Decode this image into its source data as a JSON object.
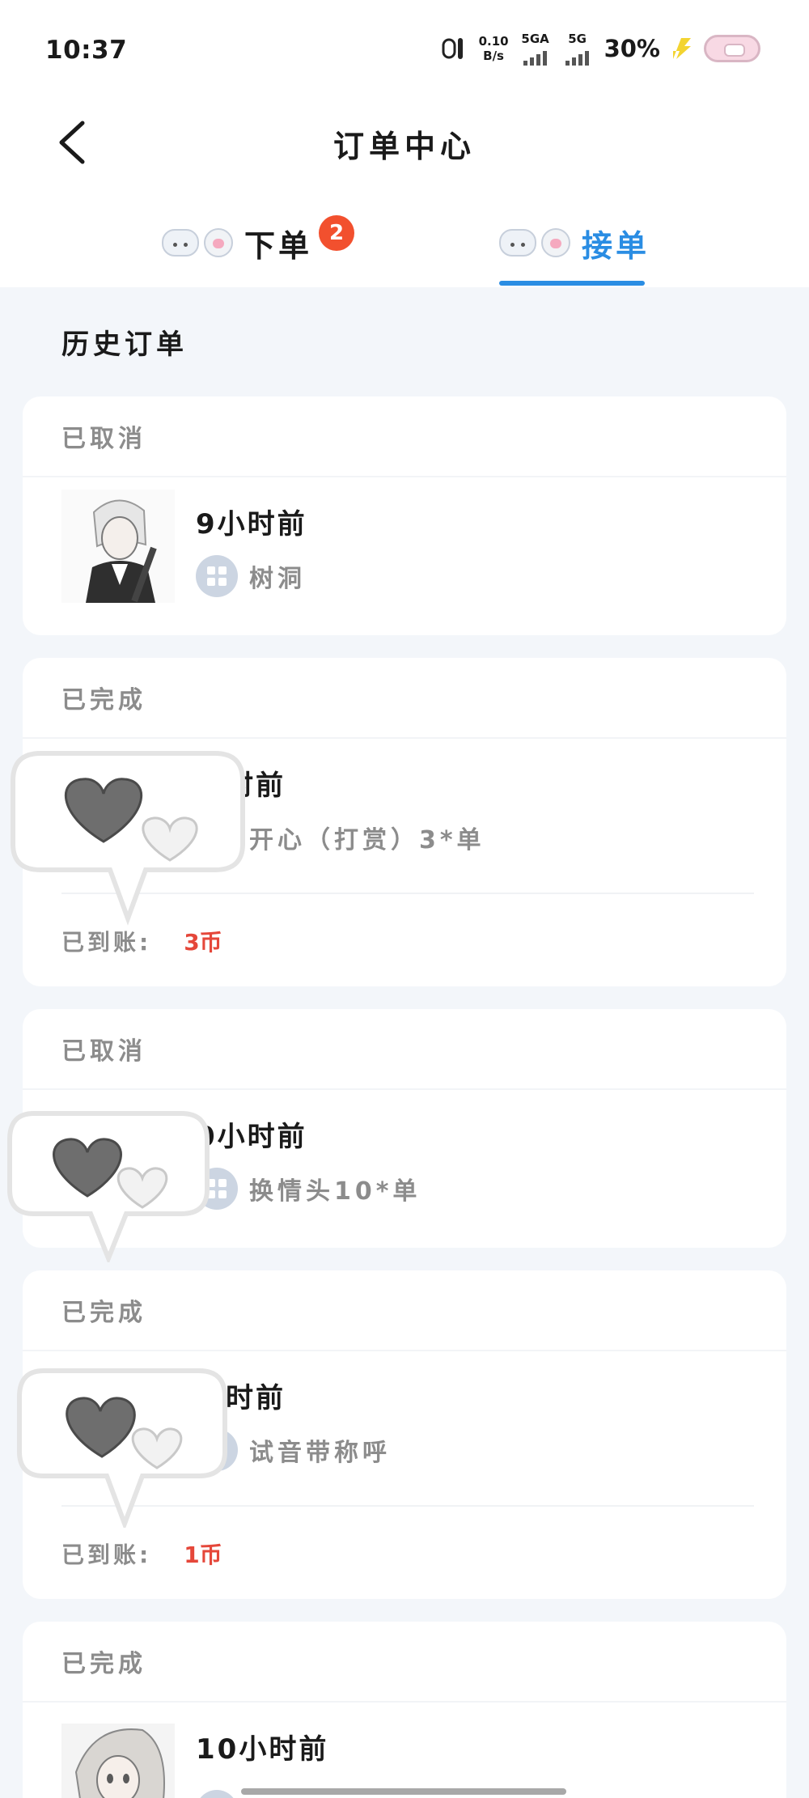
{
  "status_bar": {
    "time": "10:37",
    "net_speed": "0.10",
    "net_unit": "B/s",
    "sim1": "5GA",
    "sim2": "5G",
    "battery": "30%"
  },
  "header": {
    "title": "订单中心"
  },
  "tabs": [
    {
      "label": "下单",
      "badge": "2",
      "active": false
    },
    {
      "label": "接单",
      "active": true
    }
  ],
  "section_title": "历史订单",
  "orders": [
    {
      "status": "已取消",
      "time": "9小时前",
      "service": "树洞"
    },
    {
      "status": "已完成",
      "time": "小时前",
      "service": "开心（打赏）3*单",
      "paid_label": "已到账:",
      "paid_amount": "3币"
    },
    {
      "status": "已取消",
      "time": "0小时前",
      "service": "换情头10*单"
    },
    {
      "status": "已完成",
      "time": "小时前",
      "service": "试音带称呼",
      "paid_label": "已到账:",
      "paid_amount": "1币"
    },
    {
      "status": "已完成",
      "time": "10小时前"
    }
  ],
  "colors": {
    "accent": "#2a8de3",
    "badge": "#f2502e",
    "amount": "#e5473a",
    "background": "#f3f6fa"
  },
  "icons": [
    "back-chevron-icon",
    "cat-face-icon",
    "paw-icon",
    "grid-icon",
    "heart-bubble-sticker"
  ]
}
